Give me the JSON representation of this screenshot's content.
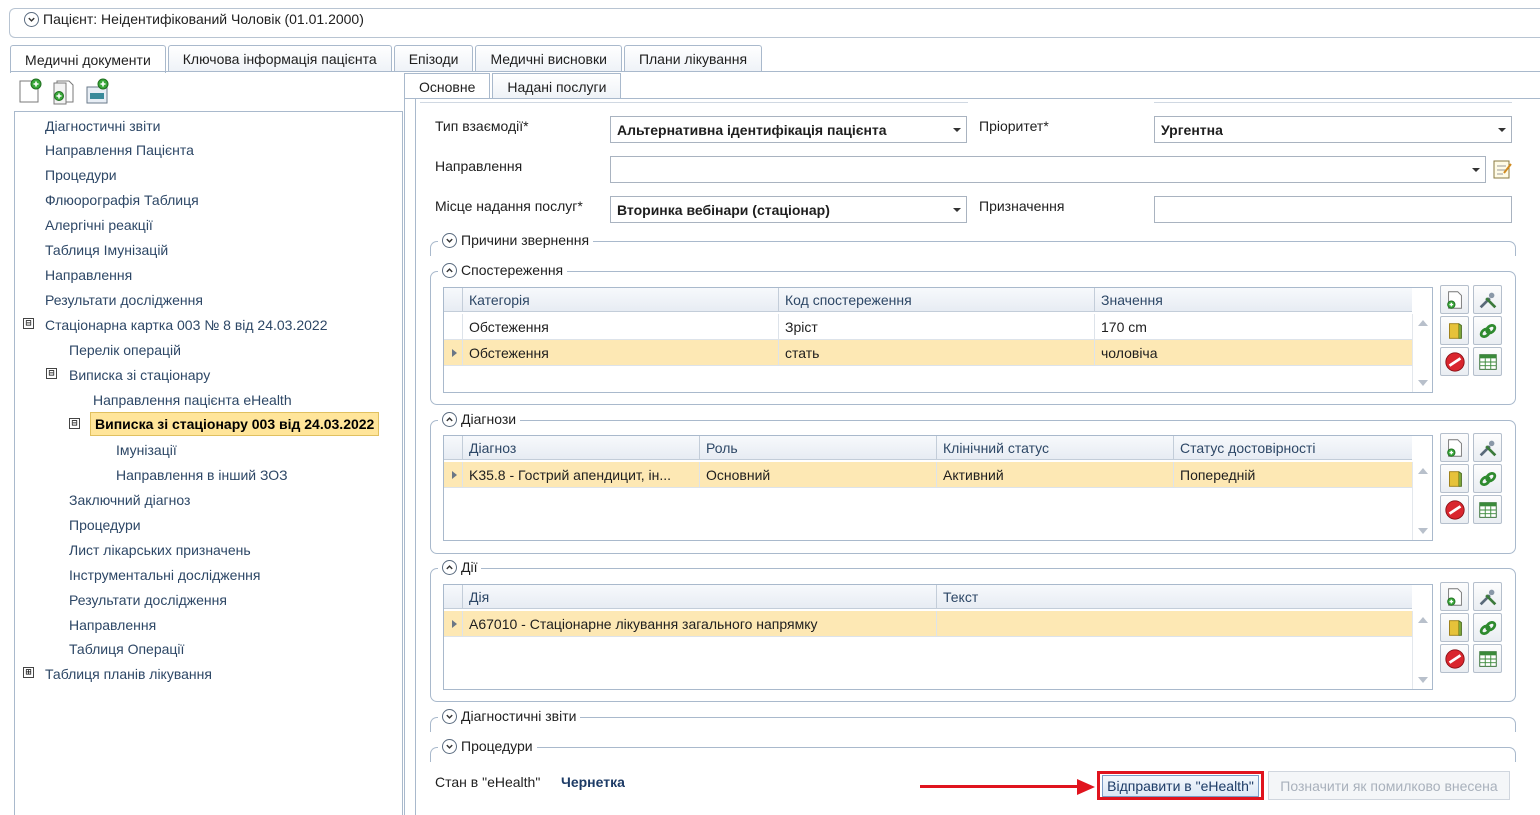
{
  "patient": {
    "title": "Пацієнт: Неідентифікований Чоловік (01.01.2000)"
  },
  "main_tabs": [
    {
      "label": "Медичні документи"
    },
    {
      "label": "Ключова інформація пацієнта"
    },
    {
      "label": "Епізоди"
    },
    {
      "label": "Медичні висновки"
    },
    {
      "label": "Плани лікування"
    }
  ],
  "left_toolbar": [
    {
      "icon": "new-document-icon"
    },
    {
      "icon": "add-document-icon"
    },
    {
      "icon": "add-record-icon"
    }
  ],
  "tree": [
    {
      "label": "Діагностичні звіти"
    },
    {
      "label": "Направлення Пацієнта"
    },
    {
      "label": "Процедури"
    },
    {
      "label": "Флюорографія Таблиця"
    },
    {
      "label": "Алергічні реакції"
    },
    {
      "label": "Таблиця Імунізацій"
    },
    {
      "label": "Направлення"
    },
    {
      "label": "Результати дослідження"
    },
    {
      "label": "Стаціонарна картка 003 № 8 від 24.03.2022",
      "expander": "⊟"
    },
    {
      "label": "Перелік операцій"
    },
    {
      "label": "Виписка зі стаціонару",
      "expander": "⊟"
    },
    {
      "label": "Направлення пацієнта eHealth"
    },
    {
      "label": "Виписка зі стаціонару 003 від 24.03.2022",
      "expander": "⊟"
    },
    {
      "label": "Імунізації"
    },
    {
      "label": "Направлення в інший ЗОЗ"
    },
    {
      "label": "Заключний діагноз"
    },
    {
      "label": "Процедури"
    },
    {
      "label": "Лист лікарських призначень"
    },
    {
      "label": "Інструментальні дослідження"
    },
    {
      "label": "Результати дослідження"
    },
    {
      "label": "Направлення"
    },
    {
      "label": "Таблиця Операції"
    },
    {
      "label": "Таблиця планів лікування",
      "expander": "⊞"
    }
  ],
  "sub_tabs": [
    {
      "label": "Основне"
    },
    {
      "label": "Надані послуги"
    }
  ],
  "form": {
    "interaction_type_label": "Тип взаємодії*",
    "interaction_type_value": "Альтернативна ідентифікація пацієнта",
    "priority_label": "Пріоритет*",
    "priority_value": "Ургентна",
    "referral_label": "Направлення",
    "referral_value": "",
    "place_label": "Місце надання послуг*",
    "place_value": "Вторинка вебінари (стаціонар)",
    "purpose_label": "Призначення",
    "purpose_value": ""
  },
  "groups": {
    "reasons": "Причини звернення",
    "observations": "Спостереження",
    "diagnoses": "Діагнози",
    "actions": "Дії",
    "diag_reports": "Діагностичні звіти",
    "procedures": "Процедури"
  },
  "observations": {
    "columns": [
      "Категорія",
      "Код спостереження",
      "Значення"
    ],
    "rows": [
      [
        "Обстеження",
        "Зріст",
        "170 cm"
      ],
      [
        "Обстеження",
        "стать",
        "чоловіча"
      ]
    ]
  },
  "diagnoses": {
    "columns": [
      "Діагноз",
      "Роль",
      "Клінічний статус",
      "Статус достовірності"
    ],
    "rows": [
      [
        "K35.8 - Гострий апендицит, ін...",
        "Основний",
        "Активний",
        "Попередній"
      ]
    ]
  },
  "actions": {
    "columns": [
      "Дія",
      "Текст"
    ],
    "rows": [
      [
        "A67010 - Стаціонарне лікування загального напрямку",
        ""
      ]
    ]
  },
  "footer": {
    "status_label": "Стан в \"eHealth\"",
    "status_value": "Чернетка",
    "send_button": "Відправити в \"eHealth\"",
    "mark_error_button": "Позначити як помилково внесена"
  },
  "colors": {
    "highlight_row": "#fde8b4",
    "selected_tree": "#ffe59a",
    "annotation_red": "#e0141e",
    "border": "#a9b9cc"
  }
}
